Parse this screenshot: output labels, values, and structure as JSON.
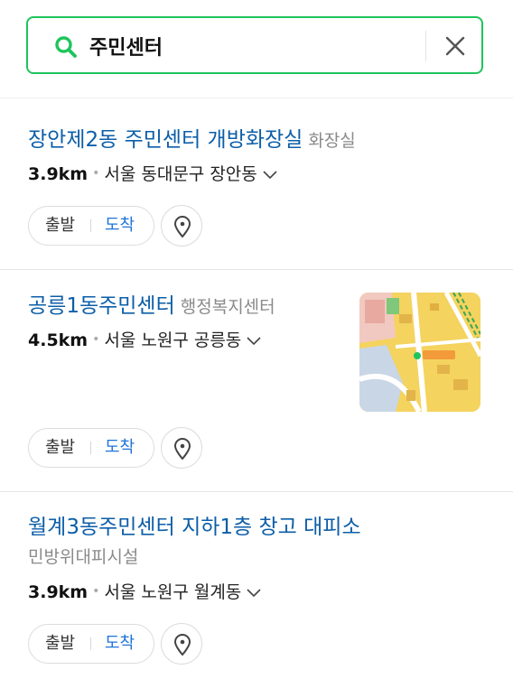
{
  "search": {
    "value": "주민센터",
    "icon": "search-icon",
    "clear_icon": "close-icon",
    "accent_color": "#1fc45c"
  },
  "results": [
    {
      "title": "장안제2동 주민센터 개방화장실",
      "category": "화장실",
      "distance": "3.9km",
      "address": "서울 동대문구 장안동",
      "depart_label": "출발",
      "arrive_label": "도착"
    },
    {
      "title": "공릉1동주민센터",
      "category": "행정복지센터",
      "distance": "4.5km",
      "address": "서울 노원구 공릉동",
      "depart_label": "출발",
      "arrive_label": "도착",
      "thumbnail": "map-thumbnail"
    },
    {
      "title": "월계3동주민센터 지하1층 창고 대피소",
      "category": "민방위대피시설",
      "distance": "3.9km",
      "address": "서울 노원구 월계동",
      "depart_label": "출발",
      "arrive_label": "도착"
    }
  ],
  "colors": {
    "title_link": "#0c5ea8",
    "arrive": "#1f74d9",
    "category": "#8a8a8a"
  }
}
